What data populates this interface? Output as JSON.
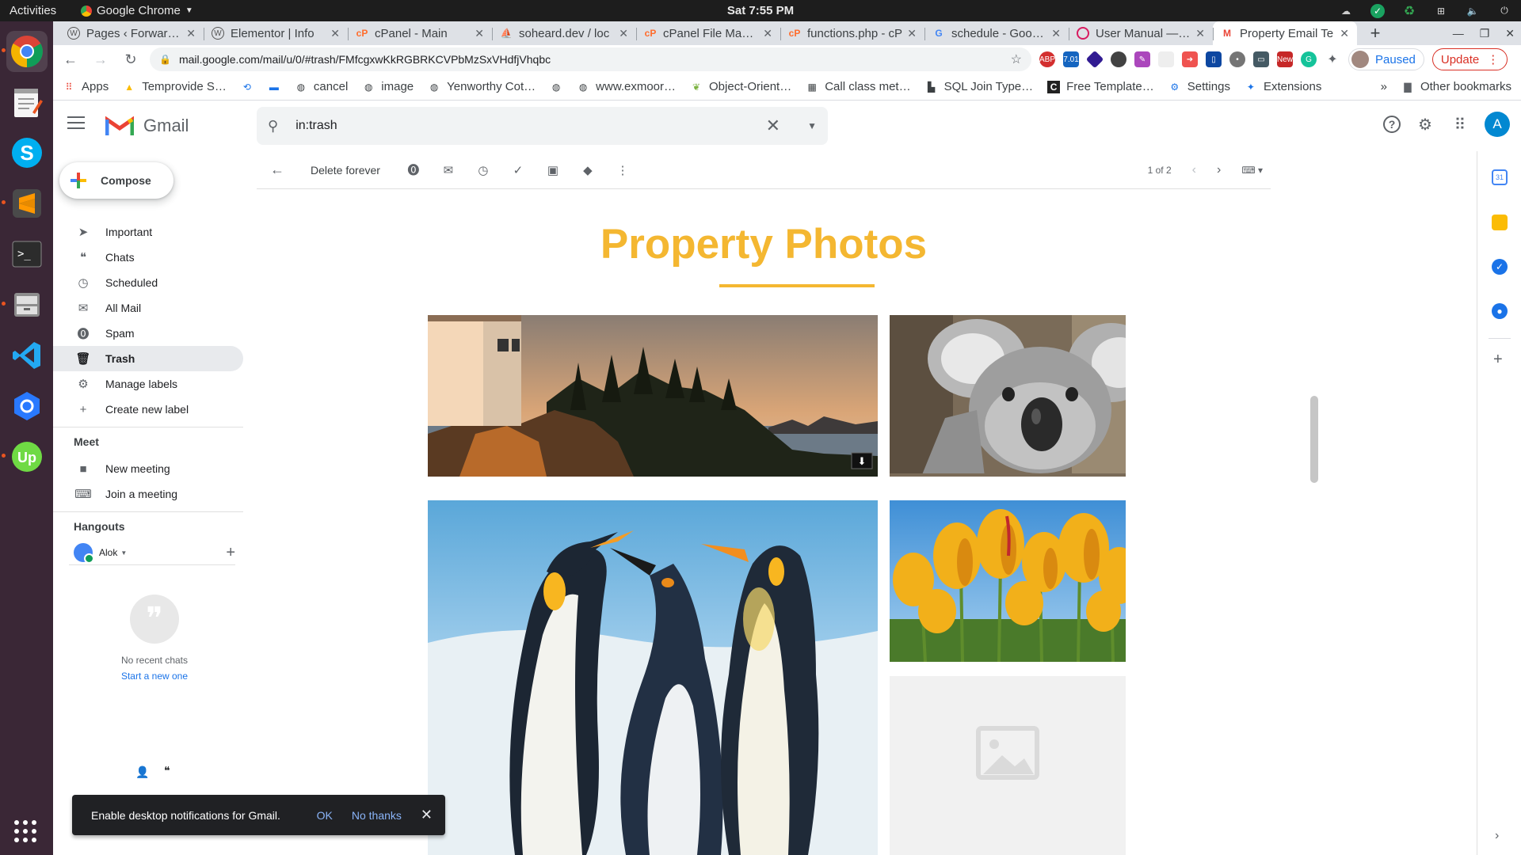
{
  "os": {
    "activities": "Activities",
    "app_name": "Google Chrome",
    "clock": "Sat  7:55 PM"
  },
  "browser": {
    "tabs": [
      {
        "title": "Pages ‹ ForwardLi",
        "icon": "wordpress-icon"
      },
      {
        "title": "Elementor | Info",
        "icon": "wordpress-icon"
      },
      {
        "title": "cPanel - Main",
        "icon": "cpanel-icon"
      },
      {
        "title": "soheard.dev / loc",
        "icon": "phpmyadmin-icon"
      },
      {
        "title": "cPanel File Manag",
        "icon": "cpanel-icon"
      },
      {
        "title": "functions.php - cP",
        "icon": "cpanel-icon"
      },
      {
        "title": "schedule - Google",
        "icon": "google-icon"
      },
      {
        "title": "User Manual — M",
        "icon": "manual-icon"
      },
      {
        "title": "Property Email Te",
        "icon": "gmail-icon",
        "active": true
      }
    ],
    "url": "mail.google.com/mail/u/0/#trash/FMfcgxwKkRGBRKCVPbMzSxVHdfjVhqbc",
    "profile_label": "Paused",
    "update_label": "Update",
    "bookmarks": [
      {
        "label": "Apps",
        "icon": "apps-grid-icon"
      },
      {
        "label": "Temprovide S…",
        "icon": "temprovide-icon"
      },
      {
        "label": "",
        "icon": "history-icon"
      },
      {
        "label": "",
        "icon": "bookmark-blue-icon"
      },
      {
        "label": "cancel",
        "icon": "globe-icon"
      },
      {
        "label": "image",
        "icon": "globe-icon"
      },
      {
        "label": "Yenworthy Cot…",
        "icon": "globe-icon"
      },
      {
        "label": "",
        "icon": "globe-icon"
      },
      {
        "label": "www.exmoor…",
        "icon": "globe-icon"
      },
      {
        "label": "Object-Orient…",
        "icon": "leaf-icon"
      },
      {
        "label": "Call class met…",
        "icon": "table-icon"
      },
      {
        "label": "SQL Join Type…",
        "icon": "sql-icon"
      },
      {
        "label": "Free Template…",
        "icon": "c-icon"
      },
      {
        "label": "Settings",
        "icon": "settings-gear-icon"
      },
      {
        "label": "Extensions",
        "icon": "puzzle-icon"
      }
    ],
    "bookmarks_overflow": "»",
    "other_bookmarks": "Other bookmarks"
  },
  "gmail": {
    "product_name": "Gmail",
    "search_query": "in:trash",
    "account_initial": "A",
    "compose_label": "Compose",
    "nav_items": [
      {
        "label": "Important",
        "icon": "important-icon"
      },
      {
        "label": "Chats",
        "icon": "chat-icon"
      },
      {
        "label": "Scheduled",
        "icon": "scheduled-icon"
      },
      {
        "label": "All Mail",
        "icon": "all-mail-icon"
      },
      {
        "label": "Spam",
        "icon": "spam-icon"
      },
      {
        "label": "Trash",
        "icon": "trash-icon",
        "selected": true
      },
      {
        "label": "Manage labels",
        "icon": "gear-icon"
      },
      {
        "label": "Create new label",
        "icon": "plus-icon"
      }
    ],
    "meet": {
      "title": "Meet",
      "items": [
        {
          "label": "New meeting",
          "icon": "video-camera-icon"
        },
        {
          "label": "Join a meeting",
          "icon": "keyboard-icon"
        }
      ]
    },
    "hangouts": {
      "title": "Hangouts",
      "user": "Alok",
      "no_chats": "No recent chats",
      "start_new": "Start a new one"
    },
    "toolbar": {
      "delete_forever": "Delete forever",
      "pager": "1 of 2"
    },
    "email": {
      "heading": "Property Photos",
      "accent_color": "#f4b731",
      "photos": [
        {
          "subject": "lighthouse at sunset",
          "icon": "photo-lighthouse"
        },
        {
          "subject": "koala",
          "icon": "photo-koala"
        },
        {
          "subject": "penguins",
          "icon": "photo-penguins"
        },
        {
          "subject": "yellow tulips",
          "icon": "photo-tulips"
        },
        {
          "subject": "image placeholder",
          "icon": "image-placeholder-icon"
        }
      ]
    },
    "snackbar": {
      "message": "Enable desktop notifications for Gmail.",
      "ok": "OK",
      "no_thanks": "No thanks"
    }
  }
}
